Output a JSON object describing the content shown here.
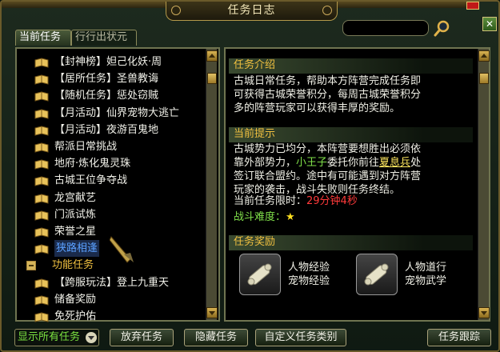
{
  "window": {
    "title": "任务日志",
    "close_label": "✕"
  },
  "tabs": [
    {
      "label": "当前任务",
      "active": true
    },
    {
      "label": "行行出状元",
      "active": false
    }
  ],
  "search": {
    "value": "",
    "placeholder": ""
  },
  "quest_list": [
    {
      "type": "quest",
      "label": "【封神榜】妲己化妖·周",
      "color": "white"
    },
    {
      "type": "quest",
      "label": "【居所任务】圣兽教诲",
      "color": "white"
    },
    {
      "type": "quest",
      "label": "【随机任务】惩处窃贼",
      "color": "white"
    },
    {
      "type": "quest",
      "label": "【月活动】仙界宠物大逃亡",
      "color": "white"
    },
    {
      "type": "quest",
      "label": "【月活动】夜游百鬼地",
      "color": "white"
    },
    {
      "type": "quest",
      "label": "帮派日常挑战",
      "color": "white"
    },
    {
      "type": "quest",
      "label": "地府·炼化鬼灵珠",
      "color": "white"
    },
    {
      "type": "quest",
      "label": "古城王位争夺战",
      "color": "white"
    },
    {
      "type": "quest",
      "label": "龙宫献艺",
      "color": "white"
    },
    {
      "type": "quest",
      "label": "门派试炼",
      "color": "white"
    },
    {
      "type": "quest",
      "label": "荣誉之星",
      "color": "white"
    },
    {
      "type": "quest",
      "label": "狭路相逢",
      "color": "selected"
    },
    {
      "type": "category",
      "label": "功能任务",
      "color": "gold"
    },
    {
      "type": "quest",
      "label": "【跨服玩法】登上九重天",
      "color": "white"
    },
    {
      "type": "quest",
      "label": "储备奖励",
      "color": "white"
    },
    {
      "type": "quest",
      "label": "免死护佑",
      "color": "white"
    }
  ],
  "detail": {
    "intro_header": "任务介绍",
    "intro_text": "古城日常任务，帮助本方阵营完成任务即可获得古城荣誉积分，每周古城荣誉积分多的阵营玩家可以获得丰厚的奖励。",
    "hint_header": "当前提示",
    "hint_line1": "古城势力已均分，本阵营要想胜出必须依靠外部势力，",
    "hint_npc": "小王子",
    "hint_mid": "委托你前往",
    "hint_place": "夏息兵",
    "hint_line2": "处签订联合盟约。途中有可能遇到对方阵营玩家的袭击，战斗失败则任务终结。",
    "time_label": "当前任务限时：",
    "time_value": "29分钟4秒",
    "difficulty_label": "战斗难度：",
    "difficulty_stars": 1,
    "difficulty_star": "★",
    "reward_header": "任务奖励",
    "rewards": [
      {
        "line1": "人物经验",
        "line2": "宠物经验",
        "icon": "scroll-icon"
      },
      {
        "line1": "人物道行",
        "line2": "宠物武学",
        "icon": "scroll-icon"
      }
    ]
  },
  "bottom": {
    "filter_value": "显示所有任务",
    "abandon": "放弃任务",
    "hide": "隐藏任务",
    "custom": "自定义任务类别",
    "track": "任务跟踪"
  },
  "colors": {
    "gold": "#f0c040",
    "green_text": "#7ae040",
    "selected_text": "#5aa0ff",
    "red_time": "#ff3a3a"
  }
}
